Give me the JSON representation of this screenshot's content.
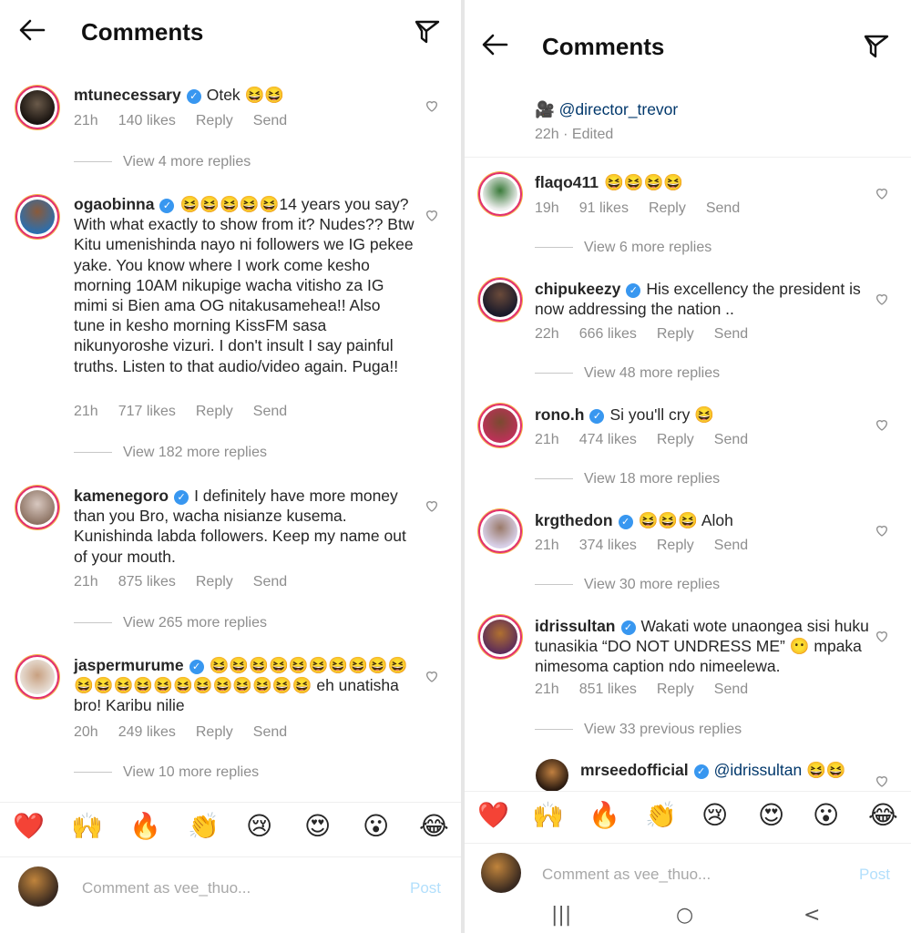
{
  "left": {
    "header": {
      "title": "Comments"
    },
    "comments": [
      {
        "username": "mtunecessary",
        "verified": true,
        "text": "Otek 😆😆",
        "time": "21h",
        "likes": "140 likes",
        "reply": "Reply",
        "send": "Send",
        "view_replies": "View 4 more replies"
      },
      {
        "username": "ogaobinna",
        "verified": true,
        "text": "😆😆😆😆😆14 years you say? With what exactly to show from it? Nudes?? Btw Kitu umenishinda nayo ni followers we IG pekee yake. You know where I work come kesho morning 10AM nikupige wacha vitisho za IG mimi si Bien ama OG nitakusamehea!! Also tune in kesho morning KissFM sasa nikunyoroshe vizuri. I don't insult I say painful truths. Listen to that audio/video again. Puga!!",
        "time": "21h",
        "likes": "717 likes",
        "reply": "Reply",
        "send": "Send",
        "view_replies": "View 182 more replies"
      },
      {
        "username": "kamenegoro",
        "verified": true,
        "text": "I definitely have more money than you Bro, wacha nisianze kusema. Kunishinda labda followers. Keep my name out of your mouth.",
        "time": "21h",
        "likes": "875 likes",
        "reply": "Reply",
        "send": "Send",
        "view_replies": "View 265 more replies"
      },
      {
        "username": "jaspermurume",
        "verified": true,
        "text": "😆😆😆😆😆😆😆😆😆😆😆😆😆😆😆😆😆😆😆😆😆😆 eh unatisha bro! Karibu nilie",
        "time": "20h",
        "likes": "249 likes",
        "reply": "Reply",
        "send": "Send",
        "view_replies": "View 10 more replies"
      }
    ],
    "reactions": [
      "❤️",
      "🙌",
      "🔥",
      "👏",
      "😢",
      "😍",
      "😮",
      "😂"
    ],
    "composer": {
      "placeholder": "Comment as vee_thuo...",
      "post": "Post"
    }
  },
  "right": {
    "header": {
      "title": "Comments"
    },
    "caption": {
      "text": "🎥 @director_trevor",
      "meta": "22h · Edited"
    },
    "comments": [
      {
        "username": "flaqo411",
        "verified": false,
        "text": "😆😆😆😆",
        "time": "19h",
        "likes": "91 likes",
        "reply": "Reply",
        "send": "Send",
        "view_replies": "View 6 more replies"
      },
      {
        "username": "chipukeezy",
        "verified": true,
        "text": "His excellency the president is now addressing the nation ..",
        "time": "22h",
        "likes": "666 likes",
        "reply": "Reply",
        "send": "Send",
        "view_replies": "View 48 more replies"
      },
      {
        "username": "rono.h",
        "verified": true,
        "text": "Si you'll cry 😆",
        "time": "21h",
        "likes": "474 likes",
        "reply": "Reply",
        "send": "Send",
        "view_replies": "View 18 more replies"
      },
      {
        "username": "krgthedon",
        "verified": true,
        "text": "😆😆😆 Aloh",
        "time": "21h",
        "likes": "374 likes",
        "reply": "Reply",
        "send": "Send",
        "view_replies": "View 30 more replies"
      },
      {
        "username": "idrissultan",
        "verified": true,
        "text": "Wakati wote unaongea sisi huku tunasikia “DO NOT UNDRESS ME” 😶 mpaka nimesoma caption ndo nimeelewa.",
        "time": "21h",
        "likes": "851 likes",
        "reply": "Reply",
        "send": "Send",
        "view_replies": "View 33 previous replies"
      }
    ],
    "reply": {
      "username": "mrseedofficial",
      "verified": true,
      "text": "@idrissultan 😆😆"
    },
    "reactions": [
      "❤️",
      "🙌",
      "🔥",
      "👏",
      "😢",
      "😍",
      "😮",
      "😂"
    ],
    "composer": {
      "placeholder": "Comment as vee_thuo...",
      "post": "Post"
    },
    "nav": [
      "|||",
      "○",
      "<"
    ]
  },
  "colors": {
    "verified": "#3897f0",
    "meta": "#8e8e8e",
    "post": "#b2dffc",
    "ring": "#e1306c"
  }
}
